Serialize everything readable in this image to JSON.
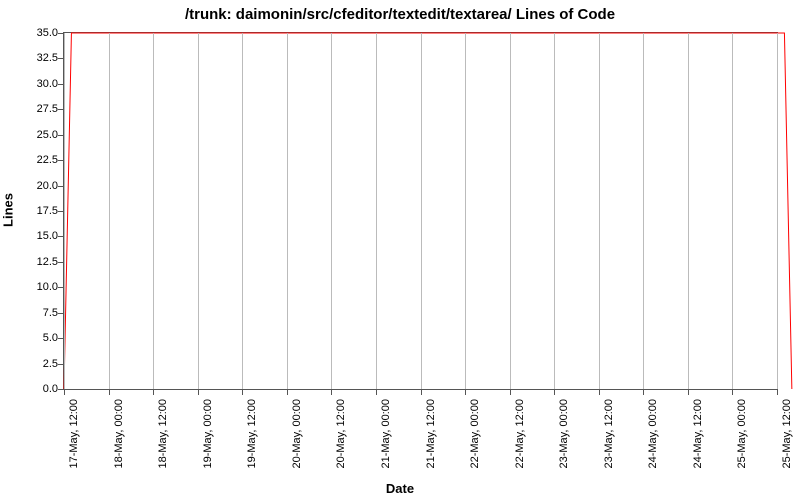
{
  "chart_data": {
    "type": "line",
    "title": "/trunk: daimonin/src/cfeditor/textedit/textarea/ Lines of Code",
    "xlabel": "Date",
    "ylabel": "Lines",
    "ylim": [
      0,
      35
    ],
    "yticks": [
      0.0,
      2.5,
      5.0,
      7.5,
      10.0,
      12.5,
      15.0,
      17.5,
      20.0,
      22.5,
      25.0,
      27.5,
      30.0,
      32.5,
      35.0
    ],
    "xticks": [
      "17-May, 12:00",
      "18-May, 00:00",
      "18-May, 12:00",
      "19-May, 00:00",
      "19-May, 12:00",
      "20-May, 00:00",
      "20-May, 12:00",
      "21-May, 00:00",
      "21-May, 12:00",
      "22-May, 00:00",
      "22-May, 12:00",
      "23-May, 00:00",
      "23-May, 12:00",
      "24-May, 00:00",
      "24-May, 12:00",
      "25-May, 00:00",
      "25-May, 12:00"
    ],
    "series": [
      {
        "name": "Lines of Code",
        "color": "#ff0000",
        "x": [
          "17-May, 12:00",
          "17-May, 14:00",
          "25-May, 14:00",
          "25-May, 16:00"
        ],
        "y": [
          0,
          35,
          35,
          0
        ]
      }
    ]
  }
}
